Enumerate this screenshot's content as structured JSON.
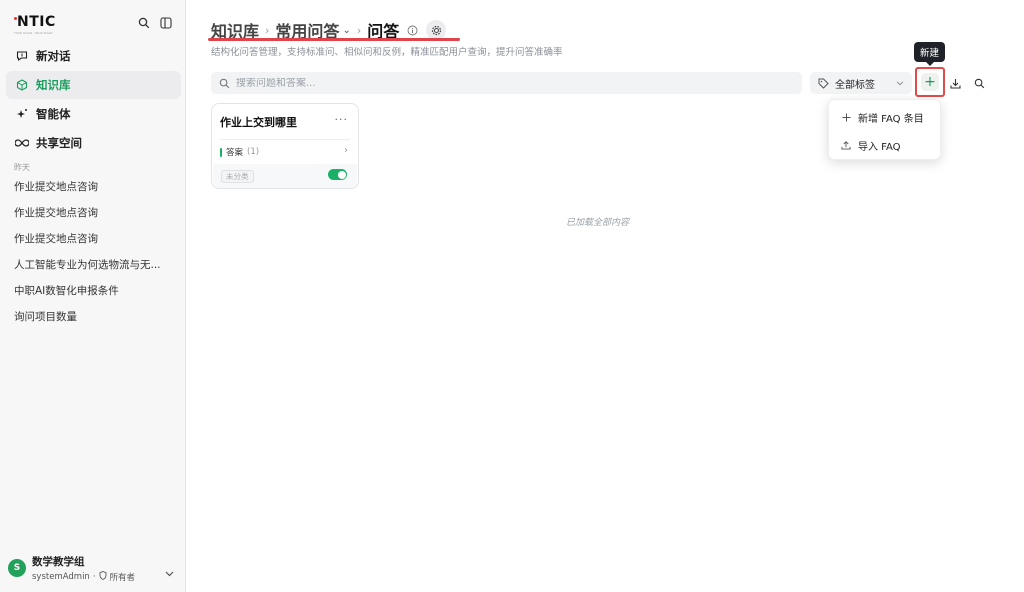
{
  "sidebar": {
    "brand": {
      "logo": "NTIC",
      "tagline": "Think Smart · Work Smart"
    },
    "nav": [
      {
        "label": "新对话",
        "icon": "chat-icon",
        "active": false
      },
      {
        "label": "知识库",
        "icon": "cube-icon",
        "active": true
      },
      {
        "label": "智能体",
        "icon": "sparkle-icon",
        "active": false
      },
      {
        "label": "共享空间",
        "icon": "infinity-icon",
        "active": false
      }
    ],
    "section_label": "昨天",
    "history": [
      "作业提交地点咨询",
      "作业提交地点咨询",
      "作业提交地点咨询",
      "人工智能专业为何选物流与无...",
      "中职AI数智化申报条件",
      "询问项目数量"
    ],
    "user": {
      "avatar_letter": "S",
      "name": "数学教学组",
      "account": "systemAdmin",
      "role": "所有者"
    }
  },
  "header": {
    "breadcrumb": [
      "知识库",
      "常用问答",
      "问答"
    ],
    "subtitle": "结构化问答管理，支持标准问、相似问和反例，精准匹配用户查询，提升问答准确率"
  },
  "toolbar": {
    "search_placeholder": "搜索问题和答案...",
    "tag_filter": "全部标签",
    "tooltip": "新建",
    "add_symbol": "+"
  },
  "dropdown": {
    "items": [
      {
        "label": "新增 FAQ 条目",
        "icon": "plus-icon"
      },
      {
        "label": "导入 FAQ",
        "icon": "upload-icon"
      }
    ]
  },
  "faq_cards": [
    {
      "title": "作业上交到哪里",
      "more": "···",
      "answer_label": "答案",
      "answer_count": "(1)",
      "category": "未分类",
      "enabled": true
    }
  ],
  "status": {
    "loaded_all": "已加载全部内容"
  },
  "colors": {
    "accent": "#1a9d5c",
    "highlight": "#e14b4b",
    "toggle_on": "#1ab067"
  }
}
